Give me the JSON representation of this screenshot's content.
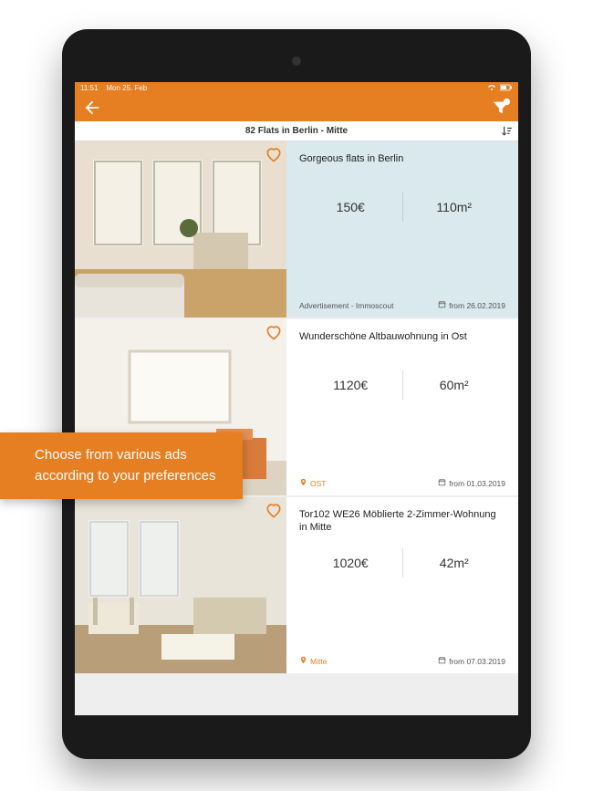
{
  "statusbar": {
    "time": "11:51",
    "date": "Mon 25. Feb"
  },
  "results": {
    "title": "82 Flats in Berlin - Mitte"
  },
  "tooltip": {
    "line1": "Choose from various ads",
    "line2": "according to your preferences"
  },
  "listings": [
    {
      "title": "Gorgeous flats in Berlin",
      "price": "150€",
      "area": "110m²",
      "sponsored": true,
      "ad_label": "Advertisement - Immoscout",
      "date": "from 26.02.2019"
    },
    {
      "title": "Wunderschöne Altbauwohnung in Ost",
      "price": "1120€",
      "area": "60m²",
      "location": "OST",
      "date": "from 01.03.2019"
    },
    {
      "title": "Tor102 WE26 Möblierte 2-Zimmer-Wohnung in Mitte",
      "price": "1020€",
      "area": "42m²",
      "location": "Mitte",
      "date": "from 07.03.2019"
    }
  ]
}
